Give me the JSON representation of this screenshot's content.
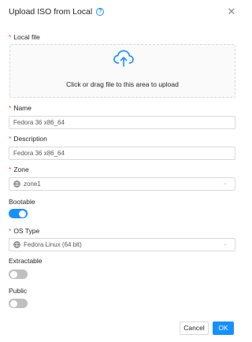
{
  "dialog": {
    "title": "Upload ISO from Local",
    "help_icon": "question-circle-icon",
    "close_icon": "close-icon"
  },
  "local_file": {
    "label": "Local file",
    "required": true,
    "dropzone_text": "Click or drag file to this area to upload",
    "icon": "cloud-upload-icon"
  },
  "name": {
    "label": "Name",
    "required": true,
    "value": "Fedora 36 x86_64"
  },
  "description": {
    "label": "Description",
    "required": true,
    "value": "Fedora 36 x86_64"
  },
  "zone": {
    "label": "Zone",
    "required": true,
    "value": "zone1",
    "icon": "globe-icon"
  },
  "bootable": {
    "label": "Bootable",
    "on": true
  },
  "os_type": {
    "label": "OS Type",
    "required": true,
    "value": "Fedora Linux (64 bit)",
    "icon": "globe-icon"
  },
  "extractable": {
    "label": "Extractable",
    "on": false
  },
  "public": {
    "label": "Public",
    "on": false
  },
  "footer": {
    "cancel_label": "Cancel",
    "ok_label": "OK"
  },
  "colors": {
    "accent": "#1890ff",
    "required": "#ff4d4f",
    "toggle_off": "#bfbfbf"
  }
}
